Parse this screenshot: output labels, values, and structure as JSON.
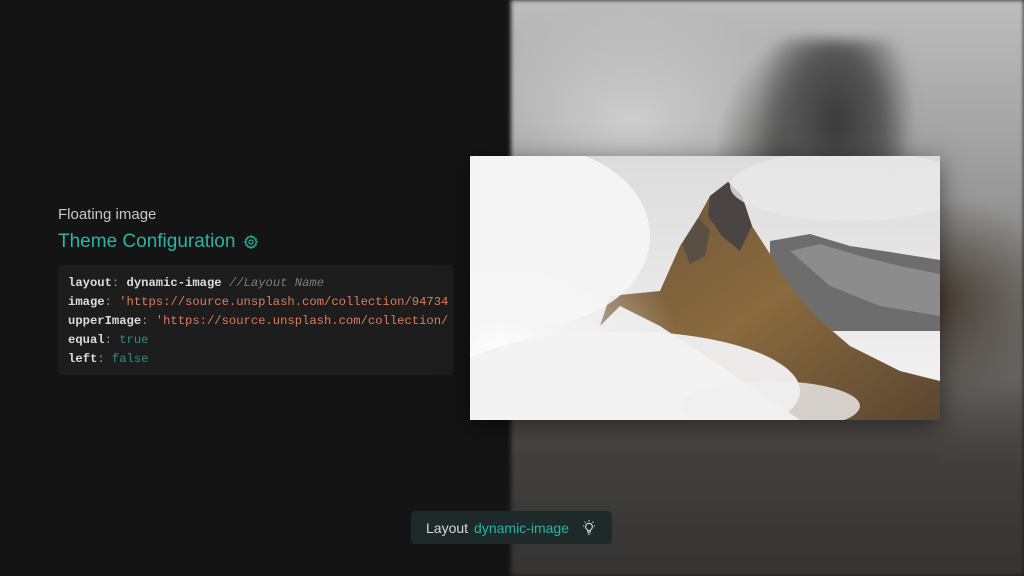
{
  "panel": {
    "subtitle": "Floating image",
    "title": "Theme Configuration",
    "settings_icon": "gear-icon"
  },
  "config": [
    {
      "key": "layout",
      "value": "dynamic-image",
      "value_type": "plain",
      "comment": "//Layout Name"
    },
    {
      "key": "image",
      "value": "'https://source.unsplash.com/collection/94734",
      "value_type": "string",
      "comment": ""
    },
    {
      "key": "upperImage",
      "value": "'https://source.unsplash.com/collection/",
      "value_type": "string",
      "comment": ""
    },
    {
      "key": "equal",
      "value": "true",
      "value_type": "bool",
      "comment": ""
    },
    {
      "key": "left",
      "value": "false",
      "value_type": "bool",
      "comment": ""
    }
  ],
  "badge": {
    "label": "Layout",
    "value": "dynamic-image",
    "icon": "lightbulb-icon"
  },
  "colors": {
    "background": "#141414",
    "accent": "#2bb3a4",
    "string": "#e07b5b",
    "bool": "#2f8f82",
    "code_bg": "#1d1d1d"
  }
}
